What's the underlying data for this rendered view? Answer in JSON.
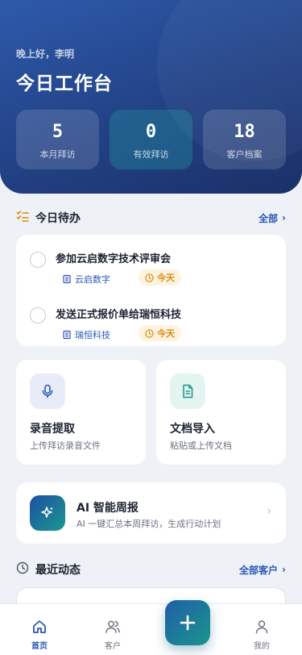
{
  "header": {
    "greeting": "晚上好，李明",
    "title": "今日工作台",
    "stats": [
      {
        "value": "5",
        "label": "本月拜访"
      },
      {
        "value": "0",
        "label": "有效拜访"
      },
      {
        "value": "18",
        "label": "客户档案"
      }
    ]
  },
  "todos": {
    "title": "今日待办",
    "more": "全部",
    "items": [
      {
        "title": "参加云启数字技术评审会",
        "org": "云启数字",
        "due": "今天"
      },
      {
        "title": "发送正式报价单给瑞恒科技",
        "org": "瑞恒科技",
        "due": "今天"
      }
    ]
  },
  "actions": [
    {
      "title": "录音提取",
      "subtitle": "上传拜访录音文件",
      "icon": "microphone-icon"
    },
    {
      "title": "文档导入",
      "subtitle": "粘贴或上传文档",
      "icon": "document-icon"
    }
  ],
  "ai_report": {
    "title": "AI 智能周报",
    "subtitle": "AI 一键汇总本周拜访，生成行动计划",
    "icon": "sparkle-icon"
  },
  "recent": {
    "title": "最近动态",
    "more": "全部客户"
  },
  "tabbar": {
    "items": [
      {
        "label": "首页",
        "icon": "home-icon",
        "active": true
      },
      {
        "label": "客户",
        "icon": "users-icon",
        "active": false
      },
      {
        "label": "我的",
        "icon": "user-icon",
        "active": false
      }
    ],
    "fab_icon": "plus-icon"
  },
  "colors": {
    "primary": "#2a56b8",
    "header_dark": "#1a3068",
    "accent_orange": "#d88a12",
    "teal": "#1a958b"
  }
}
